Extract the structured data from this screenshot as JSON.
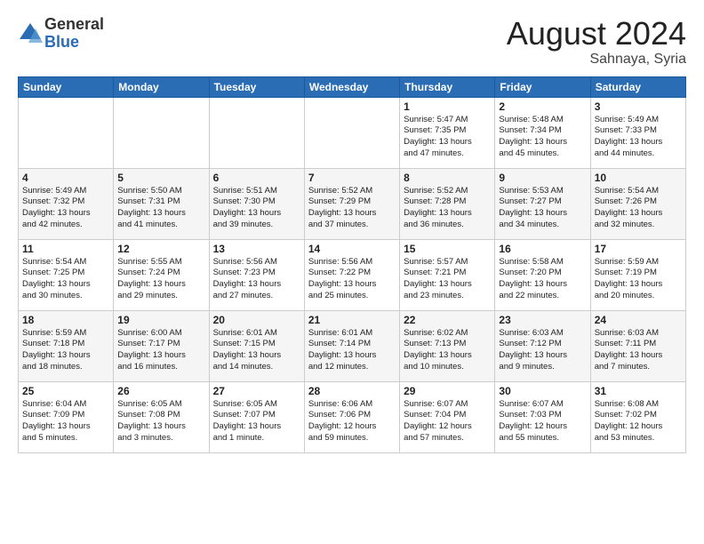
{
  "header": {
    "logo_general": "General",
    "logo_blue": "Blue",
    "month_title": "August 2024",
    "location": "Sahnaya, Syria"
  },
  "weekdays": [
    "Sunday",
    "Monday",
    "Tuesday",
    "Wednesday",
    "Thursday",
    "Friday",
    "Saturday"
  ],
  "rows": [
    [
      {
        "day": "",
        "info": ""
      },
      {
        "day": "",
        "info": ""
      },
      {
        "day": "",
        "info": ""
      },
      {
        "day": "",
        "info": ""
      },
      {
        "day": "1",
        "info": "Sunrise: 5:47 AM\nSunset: 7:35 PM\nDaylight: 13 hours\nand 47 minutes."
      },
      {
        "day": "2",
        "info": "Sunrise: 5:48 AM\nSunset: 7:34 PM\nDaylight: 13 hours\nand 45 minutes."
      },
      {
        "day": "3",
        "info": "Sunrise: 5:49 AM\nSunset: 7:33 PM\nDaylight: 13 hours\nand 44 minutes."
      }
    ],
    [
      {
        "day": "4",
        "info": "Sunrise: 5:49 AM\nSunset: 7:32 PM\nDaylight: 13 hours\nand 42 minutes."
      },
      {
        "day": "5",
        "info": "Sunrise: 5:50 AM\nSunset: 7:31 PM\nDaylight: 13 hours\nand 41 minutes."
      },
      {
        "day": "6",
        "info": "Sunrise: 5:51 AM\nSunset: 7:30 PM\nDaylight: 13 hours\nand 39 minutes."
      },
      {
        "day": "7",
        "info": "Sunrise: 5:52 AM\nSunset: 7:29 PM\nDaylight: 13 hours\nand 37 minutes."
      },
      {
        "day": "8",
        "info": "Sunrise: 5:52 AM\nSunset: 7:28 PM\nDaylight: 13 hours\nand 36 minutes."
      },
      {
        "day": "9",
        "info": "Sunrise: 5:53 AM\nSunset: 7:27 PM\nDaylight: 13 hours\nand 34 minutes."
      },
      {
        "day": "10",
        "info": "Sunrise: 5:54 AM\nSunset: 7:26 PM\nDaylight: 13 hours\nand 32 minutes."
      }
    ],
    [
      {
        "day": "11",
        "info": "Sunrise: 5:54 AM\nSunset: 7:25 PM\nDaylight: 13 hours\nand 30 minutes."
      },
      {
        "day": "12",
        "info": "Sunrise: 5:55 AM\nSunset: 7:24 PM\nDaylight: 13 hours\nand 29 minutes."
      },
      {
        "day": "13",
        "info": "Sunrise: 5:56 AM\nSunset: 7:23 PM\nDaylight: 13 hours\nand 27 minutes."
      },
      {
        "day": "14",
        "info": "Sunrise: 5:56 AM\nSunset: 7:22 PM\nDaylight: 13 hours\nand 25 minutes."
      },
      {
        "day": "15",
        "info": "Sunrise: 5:57 AM\nSunset: 7:21 PM\nDaylight: 13 hours\nand 23 minutes."
      },
      {
        "day": "16",
        "info": "Sunrise: 5:58 AM\nSunset: 7:20 PM\nDaylight: 13 hours\nand 22 minutes."
      },
      {
        "day": "17",
        "info": "Sunrise: 5:59 AM\nSunset: 7:19 PM\nDaylight: 13 hours\nand 20 minutes."
      }
    ],
    [
      {
        "day": "18",
        "info": "Sunrise: 5:59 AM\nSunset: 7:18 PM\nDaylight: 13 hours\nand 18 minutes."
      },
      {
        "day": "19",
        "info": "Sunrise: 6:00 AM\nSunset: 7:17 PM\nDaylight: 13 hours\nand 16 minutes."
      },
      {
        "day": "20",
        "info": "Sunrise: 6:01 AM\nSunset: 7:15 PM\nDaylight: 13 hours\nand 14 minutes."
      },
      {
        "day": "21",
        "info": "Sunrise: 6:01 AM\nSunset: 7:14 PM\nDaylight: 13 hours\nand 12 minutes."
      },
      {
        "day": "22",
        "info": "Sunrise: 6:02 AM\nSunset: 7:13 PM\nDaylight: 13 hours\nand 10 minutes."
      },
      {
        "day": "23",
        "info": "Sunrise: 6:03 AM\nSunset: 7:12 PM\nDaylight: 13 hours\nand 9 minutes."
      },
      {
        "day": "24",
        "info": "Sunrise: 6:03 AM\nSunset: 7:11 PM\nDaylight: 13 hours\nand 7 minutes."
      }
    ],
    [
      {
        "day": "25",
        "info": "Sunrise: 6:04 AM\nSunset: 7:09 PM\nDaylight: 13 hours\nand 5 minutes."
      },
      {
        "day": "26",
        "info": "Sunrise: 6:05 AM\nSunset: 7:08 PM\nDaylight: 13 hours\nand 3 minutes."
      },
      {
        "day": "27",
        "info": "Sunrise: 6:05 AM\nSunset: 7:07 PM\nDaylight: 13 hours\nand 1 minute."
      },
      {
        "day": "28",
        "info": "Sunrise: 6:06 AM\nSunset: 7:06 PM\nDaylight: 12 hours\nand 59 minutes."
      },
      {
        "day": "29",
        "info": "Sunrise: 6:07 AM\nSunset: 7:04 PM\nDaylight: 12 hours\nand 57 minutes."
      },
      {
        "day": "30",
        "info": "Sunrise: 6:07 AM\nSunset: 7:03 PM\nDaylight: 12 hours\nand 55 minutes."
      },
      {
        "day": "31",
        "info": "Sunrise: 6:08 AM\nSunset: 7:02 PM\nDaylight: 12 hours\nand 53 minutes."
      }
    ]
  ]
}
